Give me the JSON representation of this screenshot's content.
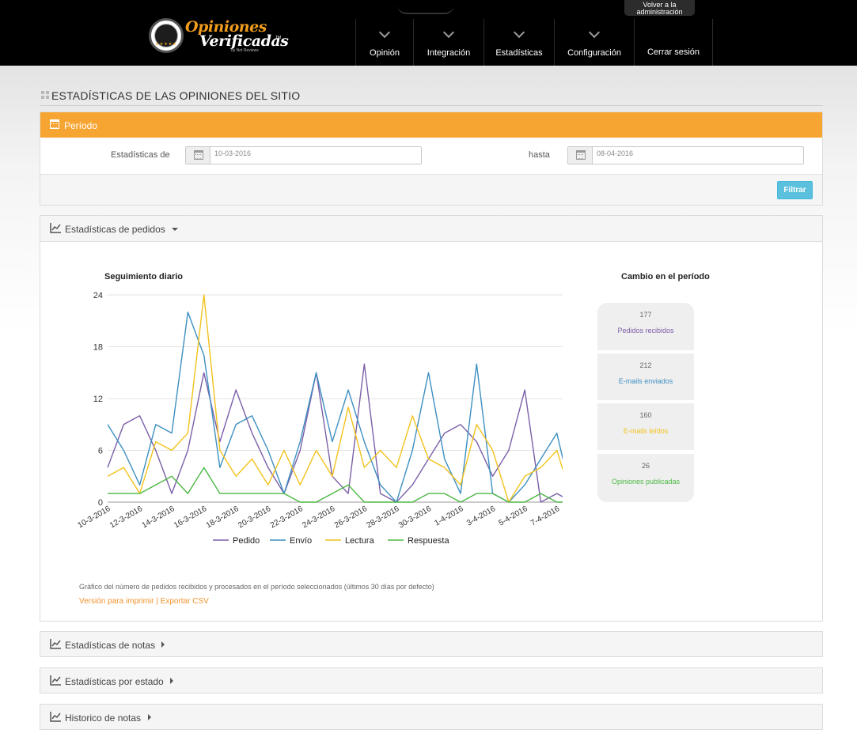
{
  "header": {
    "admin_tab_line1": "Volver a la",
    "admin_tab_line2": "administración",
    "logo": {
      "line1": "Opiniones",
      "line2": "Verificadas",
      "tm": "TM",
      "by": "by Net Reviews",
      "badge_line1": "Opiniones",
      "badge_line2": "Verificadas"
    },
    "nav": [
      {
        "label": "Opinión"
      },
      {
        "label": "Integración"
      },
      {
        "label": "Estadísticas"
      },
      {
        "label": "Configuración"
      },
      {
        "label": "Cerrar sesión"
      }
    ]
  },
  "page": {
    "title": "ESTADÍSTICAS DE LAS OPINIONES DEL SITIO"
  },
  "period": {
    "heading": "Período",
    "from_label": "Estadísticas de",
    "from_value": "10-03-2016",
    "to_label": "hasta",
    "to_value": "08-04-2016",
    "filter_button": "Filtrar"
  },
  "orders_panel": {
    "heading": "Estadísticas de pedidos",
    "chart_title": "Seguimiento diario",
    "change_title": "Cambio en el período",
    "change_cards": [
      {
        "value": "177",
        "label": "Pedidos recibidos",
        "color": "#7b5fa8"
      },
      {
        "value": "212",
        "label": "E-mails enviados",
        "color": "#3d8fc1"
      },
      {
        "value": "160",
        "label": "E-mails leídos",
        "color": "#f2c21c"
      },
      {
        "value": "26",
        "label": "Opiniones publicadas",
        "color": "#4cb843"
      }
    ],
    "note": "Gráfico del número de pedidos recibidos y procesados en el período seleccionados (últimos 30 días por defecto)",
    "print_link": "Versión para imprimir",
    "separator": "|",
    "csv_link": "Exportar CSV"
  },
  "collapsed_panels": [
    {
      "heading": "Estadísticas de notas"
    },
    {
      "heading": "Estadísticas por estado"
    },
    {
      "heading": "Historico de notas"
    }
  ],
  "colors": {
    "top_bar": "#000000",
    "accent_orange": "#f7a532",
    "filter_button": "#5bc0de",
    "link_orange": "#f0922b"
  },
  "chart_data": {
    "type": "line",
    "title": "Seguimiento diario",
    "x": [
      "10-3-2016",
      "11-3-2016",
      "12-3-2016",
      "13-3-2016",
      "14-3-2016",
      "15-3-2016",
      "16-3-2016",
      "17-3-2016",
      "18-3-2016",
      "19-3-2016",
      "20-3-2016",
      "21-3-2016",
      "22-3-2016",
      "23-3-2016",
      "24-3-2016",
      "25-3-2016",
      "26-3-2016",
      "27-3-2016",
      "28-3-2016",
      "29-3-2016",
      "30-3-2016",
      "31-3-2016",
      "1-4-2016",
      "2-4-2016",
      "3-4-2016",
      "4-4-2016",
      "5-4-2016",
      "6-4-2016",
      "7-4-2016",
      "8-4-2016"
    ],
    "x_tick_labels": [
      "10-3-2016",
      "12-3-2016",
      "14-3-2016",
      "16-3-2016",
      "18-3-2016",
      "20-3-2016",
      "22-3-2016",
      "24-3-2016",
      "26-3-2016",
      "28-3-2016",
      "30-3-2016",
      "1-4-2016",
      "3-4-2016",
      "5-4-2016",
      "7-4-2016"
    ],
    "ylim": [
      0,
      24
    ],
    "yticks": [
      0,
      6,
      12,
      18,
      24
    ],
    "grid": true,
    "legend_position": "bottom",
    "series": [
      {
        "name": "Pedido",
        "color": "#7b5fa8",
        "values": [
          4,
          9,
          10,
          6,
          1,
          6,
          15,
          7,
          13,
          8,
          4,
          1,
          6,
          15,
          3,
          1,
          16,
          1,
          0,
          2,
          5,
          8,
          9,
          7,
          3,
          6,
          13,
          0,
          1,
          0
        ]
      },
      {
        "name": "Envío",
        "color": "#3d8fc1",
        "values": [
          9,
          6,
          2,
          9,
          8,
          22,
          17,
          4,
          9,
          10,
          6,
          1,
          7,
          15,
          7,
          13,
          7,
          2,
          0,
          6,
          15,
          5,
          1,
          16,
          1,
          0,
          2,
          5,
          8,
          0
        ]
      },
      {
        "name": "Lectura",
        "color": "#f2c21c",
        "values": [
          3,
          4,
          1,
          7,
          6,
          8,
          24,
          6,
          3,
          5,
          2,
          6,
          2,
          6,
          3,
          11,
          4,
          6,
          4,
          10,
          5,
          4,
          2,
          9,
          6,
          0,
          3,
          4,
          6,
          0
        ]
      },
      {
        "name": "Respuesta",
        "color": "#4cb843",
        "values": [
          1,
          1,
          1,
          2,
          3,
          1,
          4,
          1,
          1,
          1,
          1,
          1,
          0,
          0,
          1,
          2,
          0,
          0,
          0,
          0,
          1,
          1,
          0,
          1,
          1,
          0,
          0,
          1,
          0,
          0
        ]
      }
    ]
  }
}
